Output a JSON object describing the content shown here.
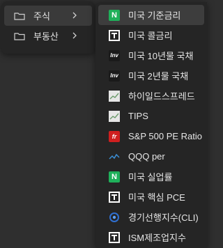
{
  "main_menu": {
    "items": [
      {
        "label": "주식",
        "icon": "folder-icon",
        "has_submenu": true
      },
      {
        "label": "부동산",
        "icon": "folder-icon",
        "has_submenu": true
      }
    ]
  },
  "submenu": {
    "items": [
      {
        "label": "미국 기준금리",
        "icon": "N"
      },
      {
        "label": "미국 콜금리",
        "icon": "TE"
      },
      {
        "label": "미국 10년물 국채",
        "icon": "Inv"
      },
      {
        "label": "미국 2년물 국채",
        "icon": "Inv"
      },
      {
        "label": "하이일드스프레드",
        "icon": "chart"
      },
      {
        "label": "TIPS",
        "icon": "chart"
      },
      {
        "label": "S&P 500 PE Ratio",
        "icon": "fred"
      },
      {
        "label": "QQQ per",
        "icon": "line-chart"
      },
      {
        "label": "미국 실업률",
        "icon": "N"
      },
      {
        "label": "미국 핵심 PCE",
        "icon": "TE"
      },
      {
        "label": "경기선행지수(CLI)",
        "icon": "cli"
      },
      {
        "label": "ISM제조업지수",
        "icon": "TE"
      }
    ]
  },
  "icon_text": {
    "n": "N",
    "inv": "Inv",
    "fred": "fr"
  },
  "colors": {
    "background": "#2f2f2f",
    "menu": "#252525",
    "highlight": "#3d3d3d",
    "n_green": "#1fb05a",
    "fred_red": "#cf1f1f"
  }
}
